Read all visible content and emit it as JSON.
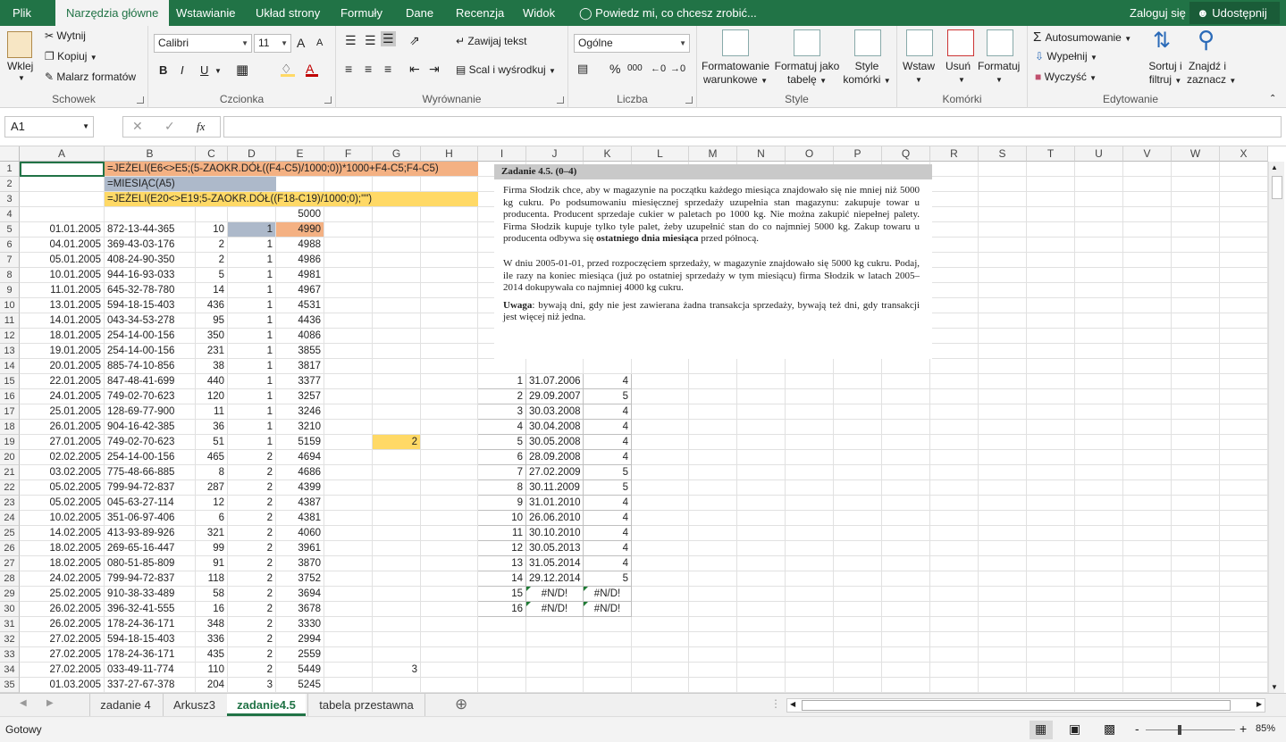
{
  "tabs": {
    "file": "Plik",
    "home": "Narzędzia główne",
    "insert": "Wstawianie",
    "layout": "Układ strony",
    "formulas": "Formuły",
    "data": "Dane",
    "review": "Recenzja",
    "view": "Widok",
    "tell": "Powiedz mi, co chcesz zrobić...",
    "signin": "Zaloguj się",
    "share": "Udostępnij"
  },
  "ribbon": {
    "clipboard": {
      "paste": "Wklej",
      "cut": "Wytnij",
      "copy": "Kopiuj",
      "painter": "Malarz formatów",
      "label": "Schowek"
    },
    "font": {
      "name": "Calibri",
      "size": "11",
      "grow": "A",
      "shrink": "A",
      "bold": "B",
      "italic": "I",
      "underline": "U",
      "label": "Czcionka"
    },
    "align": {
      "wrap": "Zawijaj tekst",
      "merge": "Scal i wyśrodkuj",
      "label": "Wyrównanie"
    },
    "number": {
      "format": "Ogólne",
      "percent": "%",
      "thousands": "000",
      "label": "Liczba"
    },
    "styles": {
      "cond1": "Formatowanie",
      "cond2": "warunkowe",
      "table1": "Formatuj jako",
      "table2": "tabelę",
      "cell1": "Style",
      "cell2": "komórki",
      "label": "Style"
    },
    "cells": {
      "insert": "Wstaw",
      "delete": "Usuń",
      "format": "Formatuj",
      "label": "Komórki"
    },
    "editing": {
      "autosum": "Autosumowanie",
      "fill": "Wypełnij",
      "clear": "Wyczyść",
      "sort1": "Sortuj i",
      "sort2": "filtruj",
      "find1": "Znajdź i",
      "find2": "zaznacz",
      "label": "Edytowanie"
    }
  },
  "formula_bar": {
    "name_box": "A1",
    "fx": "fx",
    "value": ""
  },
  "columns": [
    "A",
    "B",
    "C",
    "D",
    "E",
    "F",
    "G",
    "H",
    "I",
    "J",
    "K",
    "L",
    "M",
    "N",
    "O",
    "P",
    "Q",
    "R",
    "S",
    "T",
    "U",
    "V",
    "W",
    "X"
  ],
  "rows": [
    {
      "n": "1",
      "A": "",
      "B": "=JEŻELI(E6<>E5;(5-ZAOKR.DÓŁ((F4-C5)/1000;0))*1000+F4-C5;F4-C5)",
      "C": "",
      "D": "",
      "E": ""
    },
    {
      "n": "2",
      "A": "",
      "B": "=MIESIĄC(A5)",
      "C": "",
      "D": "",
      "E": ""
    },
    {
      "n": "3",
      "A": "",
      "B": "=JEŻELI(E20<>E19;5-ZAOKR.DÓŁ((F18-C19)/1000;0);\"\")",
      "C": "",
      "D": "",
      "E": ""
    },
    {
      "n": "4",
      "A": "",
      "B": "",
      "C": "",
      "D": "",
      "E": "5000"
    },
    {
      "n": "5",
      "A": "01.01.2005",
      "B": "872-13-44-365",
      "C": "10",
      "D": "1",
      "E": "4990"
    },
    {
      "n": "6",
      "A": "04.01.2005",
      "B": "369-43-03-176",
      "C": "2",
      "D": "1",
      "E": "4988"
    },
    {
      "n": "7",
      "A": "05.01.2005",
      "B": "408-24-90-350",
      "C": "2",
      "D": "1",
      "E": "4986"
    },
    {
      "n": "8",
      "A": "10.01.2005",
      "B": "944-16-93-033",
      "C": "5",
      "D": "1",
      "E": "4981"
    },
    {
      "n": "9",
      "A": "11.01.2005",
      "B": "645-32-78-780",
      "C": "14",
      "D": "1",
      "E": "4967"
    },
    {
      "n": "10",
      "A": "13.01.2005",
      "B": "594-18-15-403",
      "C": "436",
      "D": "1",
      "E": "4531"
    },
    {
      "n": "11",
      "A": "14.01.2005",
      "B": "043-34-53-278",
      "C": "95",
      "D": "1",
      "E": "4436"
    },
    {
      "n": "12",
      "A": "18.01.2005",
      "B": "254-14-00-156",
      "C": "350",
      "D": "1",
      "E": "4086"
    },
    {
      "n": "13",
      "A": "19.01.2005",
      "B": "254-14-00-156",
      "C": "231",
      "D": "1",
      "E": "3855"
    },
    {
      "n": "14",
      "A": "20.01.2005",
      "B": "885-74-10-856",
      "C": "38",
      "D": "1",
      "E": "3817"
    },
    {
      "n": "15",
      "A": "22.01.2005",
      "B": "847-48-41-699",
      "C": "440",
      "D": "1",
      "E": "3377"
    },
    {
      "n": "16",
      "A": "24.01.2005",
      "B": "749-02-70-623",
      "C": "120",
      "D": "1",
      "E": "3257"
    },
    {
      "n": "17",
      "A": "25.01.2005",
      "B": "128-69-77-900",
      "C": "11",
      "D": "1",
      "E": "3246"
    },
    {
      "n": "18",
      "A": "26.01.2005",
      "B": "904-16-42-385",
      "C": "36",
      "D": "1",
      "E": "3210"
    },
    {
      "n": "19",
      "A": "27.01.2005",
      "B": "749-02-70-623",
      "C": "51",
      "D": "1",
      "E": "5159"
    },
    {
      "n": "20",
      "A": "02.02.2005",
      "B": "254-14-00-156",
      "C": "465",
      "D": "2",
      "E": "4694"
    },
    {
      "n": "21",
      "A": "03.02.2005",
      "B": "775-48-66-885",
      "C": "8",
      "D": "2",
      "E": "4686"
    },
    {
      "n": "22",
      "A": "05.02.2005",
      "B": "799-94-72-837",
      "C": "287",
      "D": "2",
      "E": "4399"
    },
    {
      "n": "23",
      "A": "05.02.2005",
      "B": "045-63-27-114",
      "C": "12",
      "D": "2",
      "E": "4387"
    },
    {
      "n": "24",
      "A": "10.02.2005",
      "B": "351-06-97-406",
      "C": "6",
      "D": "2",
      "E": "4381"
    },
    {
      "n": "25",
      "A": "14.02.2005",
      "B": "413-93-89-926",
      "C": "321",
      "D": "2",
      "E": "4060"
    },
    {
      "n": "26",
      "A": "18.02.2005",
      "B": "269-65-16-447",
      "C": "99",
      "D": "2",
      "E": "3961"
    },
    {
      "n": "27",
      "A": "18.02.2005",
      "B": "080-51-85-809",
      "C": "91",
      "D": "2",
      "E": "3870"
    },
    {
      "n": "28",
      "A": "24.02.2005",
      "B": "799-94-72-837",
      "C": "118",
      "D": "2",
      "E": "3752"
    },
    {
      "n": "29",
      "A": "25.02.2005",
      "B": "910-38-33-489",
      "C": "58",
      "D": "2",
      "E": "3694"
    },
    {
      "n": "30",
      "A": "26.02.2005",
      "B": "396-32-41-555",
      "C": "16",
      "D": "2",
      "E": "3678"
    },
    {
      "n": "31",
      "A": "26.02.2005",
      "B": "178-24-36-171",
      "C": "348",
      "D": "2",
      "E": "3330"
    },
    {
      "n": "32",
      "A": "27.02.2005",
      "B": "594-18-15-403",
      "C": "336",
      "D": "2",
      "E": "2994"
    },
    {
      "n": "33",
      "A": "27.02.2005",
      "B": "178-24-36-171",
      "C": "435",
      "D": "2",
      "E": "2559"
    },
    {
      "n": "34",
      "A": "27.02.2005",
      "B": "033-49-11-774",
      "C": "110",
      "D": "2",
      "E": "5449"
    },
    {
      "n": "35",
      "A": "01.03.2005",
      "B": "337-27-67-378",
      "C": "204",
      "D": "3",
      "E": "5245"
    }
  ],
  "g_values": [
    {
      "row": "19",
      "value": "2"
    },
    {
      "row": "34",
      "value": "3"
    }
  ],
  "results": [
    {
      "row": "15",
      "i": "1",
      "j": "31.07.2006",
      "k": "4"
    },
    {
      "row": "16",
      "i": "2",
      "j": "29.09.2007",
      "k": "5"
    },
    {
      "row": "17",
      "i": "3",
      "j": "30.03.2008",
      "k": "4"
    },
    {
      "row": "18",
      "i": "4",
      "j": "30.04.2008",
      "k": "4"
    },
    {
      "row": "19",
      "i": "5",
      "j": "30.05.2008",
      "k": "4"
    },
    {
      "row": "20",
      "i": "6",
      "j": "28.09.2008",
      "k": "4"
    },
    {
      "row": "21",
      "i": "7",
      "j": "27.02.2009",
      "k": "5"
    },
    {
      "row": "22",
      "i": "8",
      "j": "30.11.2009",
      "k": "5"
    },
    {
      "row": "23",
      "i": "9",
      "j": "31.01.2010",
      "k": "4"
    },
    {
      "row": "24",
      "i": "10",
      "j": "26.06.2010",
      "k": "4"
    },
    {
      "row": "25",
      "i": "11",
      "j": "30.10.2010",
      "k": "4"
    },
    {
      "row": "26",
      "i": "12",
      "j": "30.05.2013",
      "k": "4"
    },
    {
      "row": "27",
      "i": "13",
      "j": "31.05.2014",
      "k": "4"
    },
    {
      "row": "28",
      "i": "14",
      "j": "29.12.2014",
      "k": "5"
    },
    {
      "row": "29",
      "i": "15",
      "j": "#N/D!",
      "k": "#N/D!"
    },
    {
      "row": "30",
      "i": "16",
      "j": "#N/D!",
      "k": "#N/D!"
    }
  ],
  "task": {
    "title": "Zadanie 4.5. (0–4)",
    "p1a": "Firma Słodzik chce, aby w magazynie na początku każdego miesiąca znajdowało się nie mniej niż 5000 kg cukru. Po podsumowaniu miesięcznej sprzedaży uzupełnia stan magazynu: zakupuje towar u producenta. Producent sprzedaje cukier w paletach po 1000 kg. Nie można zakupić niepełnej palety. Firma Słodzik kupuje tylko tyle palet, żeby uzupełnić stan do co najmniej 5000 kg. Zakup towaru u producenta odbywa się",
    "p1b": "ostatniego dnia miesiąca",
    "p1c": "przed północą.",
    "p2": "W dniu 2005-01-01, przed rozpoczęciem sprzedaży, w magazynie znajdowało się 5000 kg cukru. Podaj, ile razy na koniec miesiąca (już po ostatniej sprzedaży w tym miesiącu) firma Słodzik w latach 2005–2014 dokupywała co najmniej 4000 kg cukru.",
    "p3a": "Uwaga",
    "p3b": ": bywają dni, gdy nie jest zawierana żadna transakcja sprzedaży, bywają też dni, gdy transakcji jest więcej niż jedna."
  },
  "sheets": [
    "zadanie 4",
    "Arkusz3",
    "zadanie4.5",
    "tabela przestawna"
  ],
  "status": {
    "ready": "Gotowy",
    "zoom": "85%",
    "minus": "-",
    "plus": "+"
  },
  "colors": {
    "accent": "#217346",
    "orange": "#f4b183",
    "bluegray": "#adb9ca",
    "yellow": "#ffd966"
  }
}
